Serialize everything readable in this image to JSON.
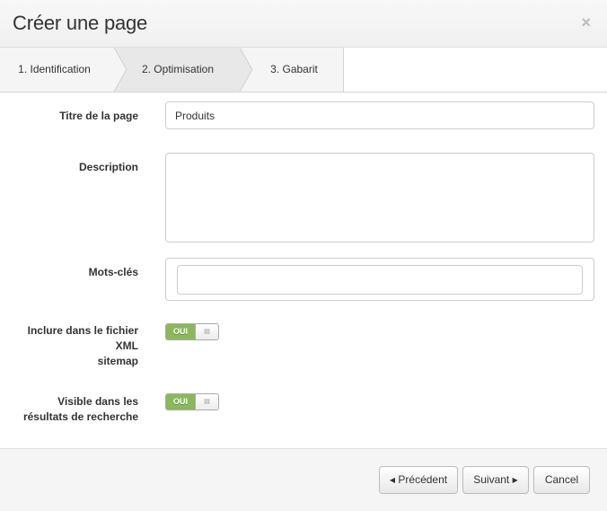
{
  "modal": {
    "title": "Créer une page",
    "close_symbol": "×"
  },
  "steps": [
    {
      "label": "1. Identification",
      "active": false
    },
    {
      "label": "2. Optimisation",
      "active": true
    },
    {
      "label": "3. Gabarit",
      "active": false
    }
  ],
  "form": {
    "title_label": "Titre de la page",
    "title_value": "Produits",
    "description_label": "Description",
    "description_value": "",
    "keywords_label": "Mots-clés",
    "keywords_value": "",
    "sitemap_label_line1": "Inclure dans le fichier",
    "sitemap_label_line2": "XML",
    "sitemap_label_line3": "sitemap",
    "sitemap_toggle": {
      "on_label": "OUI",
      "handle": "III",
      "state": true
    },
    "search_label_line1": "Visible dans les",
    "search_label_line2": "résultats de recherche",
    "search_toggle": {
      "on_label": "OUI",
      "handle": "III",
      "state": true
    }
  },
  "footer": {
    "prev_label": "Précédent",
    "prev_icon": "◀",
    "next_label": "Suivant",
    "next_icon": "▶",
    "cancel_label": "Cancel"
  },
  "colors": {
    "toggle_on": "#8cb85d",
    "active_step": "#e8e8e8"
  }
}
